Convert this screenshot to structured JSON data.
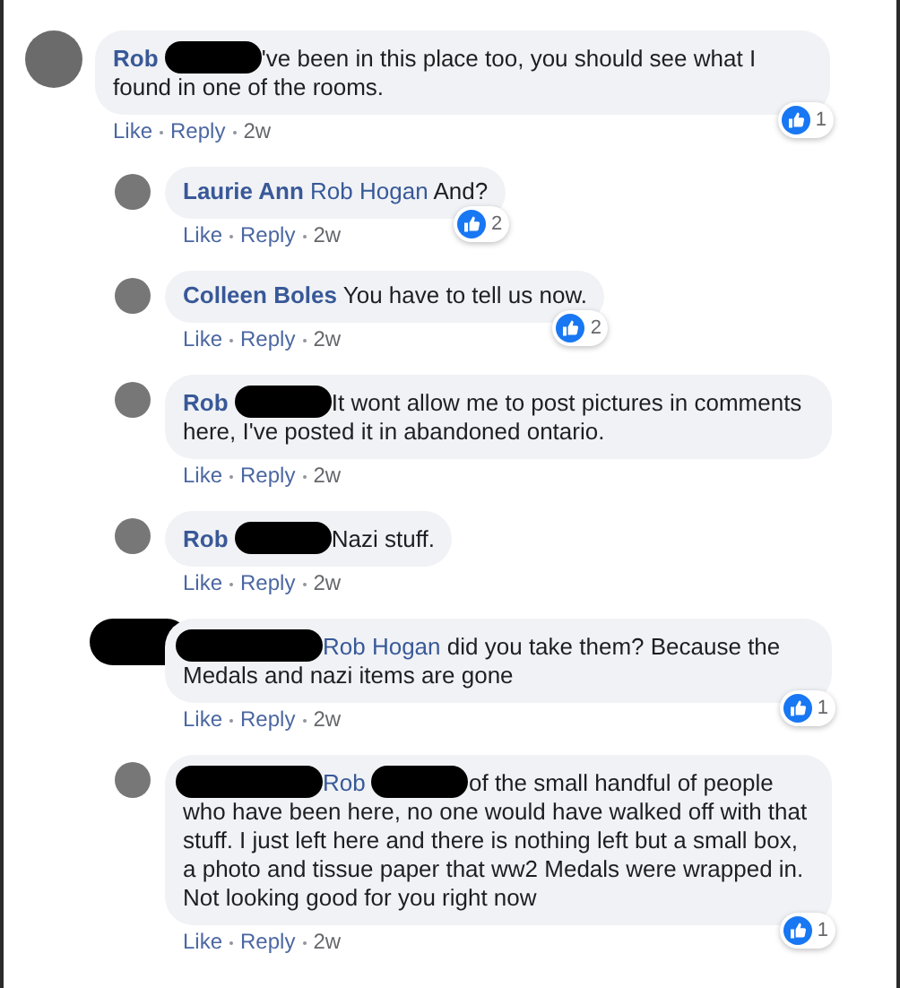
{
  "comments": [
    {
      "avatar_hidden": false,
      "segments": [
        {
          "kind": "author",
          "text": "Rob"
        },
        {
          "kind": "redaction"
        },
        {
          "kind": "text",
          "text": "'ve been in this place too, you should see what I found in one of the rooms."
        }
      ],
      "actions": [
        {
          "kind": "link",
          "label": "Like"
        },
        {
          "kind": "link",
          "label": "Reply"
        },
        {
          "kind": "time",
          "label": "2w"
        }
      ],
      "reactions": "1",
      "children": [
        {
          "avatar_hidden": false,
          "segments": [
            {
              "kind": "author",
              "text": "Laurie Ann"
            },
            {
              "kind": "mention",
              "text": "Rob Hogan"
            },
            {
              "kind": "text",
              "text": "And?"
            }
          ],
          "actions": [
            {
              "kind": "link",
              "label": "Like"
            },
            {
              "kind": "link",
              "label": "Reply"
            },
            {
              "kind": "time",
              "label": "2w"
            }
          ],
          "reactions": "2"
        },
        {
          "avatar_hidden": false,
          "segments": [
            {
              "kind": "author",
              "text": "Colleen Boles"
            },
            {
              "kind": "text",
              "text": "You have to tell us now."
            }
          ],
          "actions": [
            {
              "kind": "link",
              "label": "Like"
            },
            {
              "kind": "link",
              "label": "Reply"
            },
            {
              "kind": "time",
              "label": "2w"
            }
          ],
          "reactions": "2"
        },
        {
          "avatar_hidden": false,
          "segments": [
            {
              "kind": "author",
              "text": "Rob"
            },
            {
              "kind": "redaction"
            },
            {
              "kind": "text",
              "text": "It wont allow me to post pictures in comments here, I've posted it in abandoned ontario."
            }
          ],
          "actions": [
            {
              "kind": "link",
              "label": "Like"
            },
            {
              "kind": "link",
              "label": "Reply"
            },
            {
              "kind": "time",
              "label": "2w"
            }
          ]
        },
        {
          "avatar_hidden": false,
          "segments": [
            {
              "kind": "author",
              "text": "Rob"
            },
            {
              "kind": "redaction"
            },
            {
              "kind": "text",
              "text": "Nazi stuff."
            }
          ],
          "actions": [
            {
              "kind": "link",
              "label": "Like"
            },
            {
              "kind": "link",
              "label": "Reply"
            },
            {
              "kind": "time",
              "label": "2w"
            }
          ]
        },
        {
          "avatar_hidden": true,
          "segments": [
            {
              "kind": "long-redaction"
            },
            {
              "kind": "mention",
              "text": "Rob Hogan"
            },
            {
              "kind": "text",
              "text": "did you take them? Because the Medals and nazi items are gone"
            }
          ],
          "actions": [
            {
              "kind": "link",
              "label": "Like"
            },
            {
              "kind": "link",
              "label": "Reply"
            },
            {
              "kind": "time",
              "label": "2w"
            }
          ],
          "reactions": "1"
        },
        {
          "avatar_hidden": false,
          "segments": [
            {
              "kind": "long-redaction"
            },
            {
              "kind": "mention",
              "text": "Rob"
            },
            {
              "kind": "redaction"
            },
            {
              "kind": "text",
              "text": "of the small handful of people who have been here, no one would have walked off with that stuff. I just left here and there is nothing left but a small box, a photo and tissue paper that ww2 Medals were wrapped in. Not looking good for you right now"
            }
          ],
          "actions": [
            {
              "kind": "link",
              "label": "Like"
            },
            {
              "kind": "link",
              "label": "Reply"
            },
            {
              "kind": "time",
              "label": "2w"
            }
          ],
          "reactions": "1"
        }
      ]
    }
  ]
}
